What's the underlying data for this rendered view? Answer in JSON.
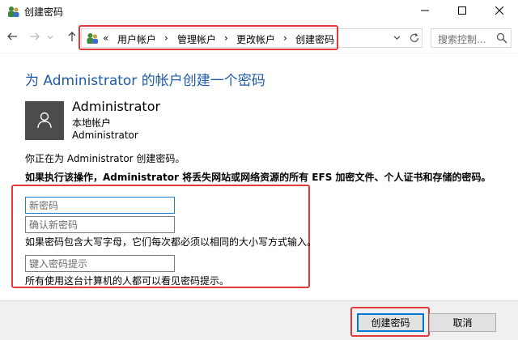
{
  "window": {
    "title": "创建密码",
    "icons": {
      "app": "user-accounts-icon",
      "minimize": "minimize-icon",
      "maximize": "maximize-icon",
      "close": "close-icon"
    }
  },
  "nav": {
    "icons": {
      "back": "arrow-left-icon",
      "forward": "arrow-right-icon",
      "recent": "chevron-down-icon",
      "up": "arrow-up-icon",
      "refresh": "refresh-icon",
      "search": "search-icon"
    },
    "overflow": "«",
    "breadcrumbs": [
      "用户帐户",
      "管理帐户",
      "更改帐户",
      "创建密码"
    ],
    "separator": "›",
    "search_placeholder": "搜索控制..."
  },
  "page": {
    "title": "为 Administrator 的帐户创建一个密码",
    "account": {
      "name": "Administrator",
      "type": "本地帐户",
      "group": "Administrator"
    },
    "intro": "你正在为 Administrator 创建密码。",
    "warning": "如果执行该操作，Administrator 将丢失网站或网络资源的所有 EFS 加密文件、个人证书和存储的密码。"
  },
  "form": {
    "new_password_placeholder": "新密码",
    "confirm_password_placeholder": "确认新密码",
    "case_note": "如果密码包含大写字母，它们每次都必须以相同的大小写方式输入。",
    "hint_placeholder": "键入密码提示",
    "hint_note": "所有使用这台计算机的人都可以看见密码提示。"
  },
  "buttons": {
    "create": "创建密码",
    "cancel": "取消"
  },
  "colors": {
    "title_blue": "#1e5aa8",
    "highlight_red": "#e0393e",
    "focus_blue": "#0078d7"
  }
}
